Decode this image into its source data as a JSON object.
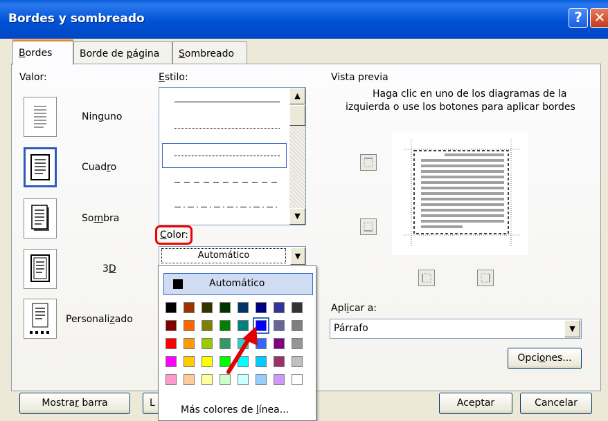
{
  "window": {
    "title": "Bordes y sombreado",
    "help_glyph": "?",
    "close_glyph": "✕"
  },
  "tabs": [
    {
      "pre": "",
      "acc": "B",
      "post": "ordes",
      "active": true
    },
    {
      "pre": "Borde de ",
      "acc": "p",
      "post": "ágina",
      "active": false
    },
    {
      "pre": "",
      "acc": "S",
      "post": "ombreado",
      "active": false
    }
  ],
  "valor": {
    "label": "Valor:",
    "options": [
      {
        "pre": "Nin",
        "acc": "g",
        "post": "uno",
        "selected": false
      },
      {
        "pre": "Cuad",
        "acc": "r",
        "post": "o",
        "selected": true
      },
      {
        "pre": "So",
        "acc": "m",
        "post": "bra",
        "selected": false
      },
      {
        "pre": "3",
        "acc": "D",
        "post": "",
        "selected": false
      },
      {
        "pre": "Personali",
        "acc": "z",
        "post": "ado",
        "selected": false
      }
    ]
  },
  "estilo": {
    "pre": "",
    "acc": "E",
    "post": "stilo:",
    "styles": [
      "solid",
      "dotted",
      "dashed-short",
      "dashed",
      "dash-dot"
    ],
    "selected_index": 2
  },
  "color": {
    "pre": "",
    "acc": "C",
    "post": "olor:",
    "value": "Automático",
    "dropdown": {
      "automatic_label": "Automático",
      "more_colors": {
        "pre": "Más colores de ",
        "acc": "l",
        "post": "ínea..."
      },
      "selected": [
        1,
        5
      ],
      "swatches": [
        [
          "#000000",
          "#993300",
          "#333300",
          "#003300",
          "#003366",
          "#000080",
          "#333399",
          "#333333"
        ],
        [
          "#800000",
          "#ff6600",
          "#808000",
          "#008000",
          "#008080",
          "#0000ff",
          "#666699",
          "#808080"
        ],
        [
          "#ff0000",
          "#ff9900",
          "#99cc00",
          "#339966",
          "#33cccc",
          "#3366ff",
          "#800080",
          "#969696"
        ],
        [
          "#ff00ff",
          "#ffcc00",
          "#ffff00",
          "#00ff00",
          "#00ffff",
          "#00ccff",
          "#993366",
          "#c0c0c0"
        ],
        [
          "#ff99cc",
          "#ffcc99",
          "#ffff99",
          "#ccffcc",
          "#ccffff",
          "#99ccff",
          "#cc99ff",
          "#ffffff"
        ]
      ]
    }
  },
  "vista": {
    "title": "Vista previa",
    "hint_line1": "Haga clic en uno de los diagramas de la",
    "hint_line2": "izquierda o use los botones para aplicar bordes"
  },
  "aplicar": {
    "pre": "Apl",
    "acc": "i",
    "post": "car a:",
    "value": "Párrafo"
  },
  "buttons": {
    "opciones": {
      "pre": "Opci",
      "acc": "o",
      "post": "nes..."
    },
    "mostrar": {
      "pre": "Mostra",
      "acc": "r",
      "post": " barra"
    },
    "partial": "L",
    "aceptar": "Aceptar",
    "cancelar": "Cancelar"
  },
  "colors": {
    "accent": "#3169c6",
    "highlight_circle": "#e00000",
    "annotation_arrow": "#e00000"
  }
}
